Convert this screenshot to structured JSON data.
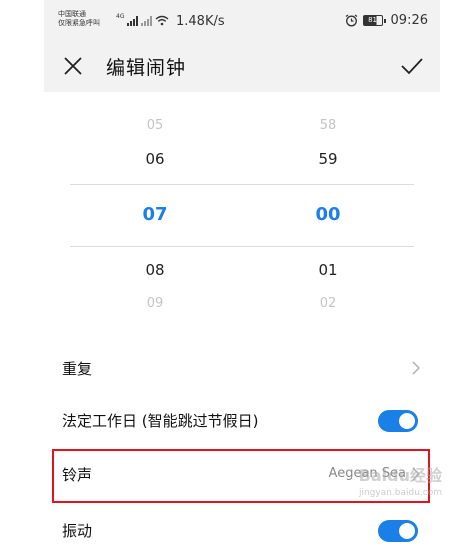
{
  "status_bar": {
    "carrier_line1": "中国联通",
    "carrier_line2": "仅限紧急呼叫",
    "network_tag": "4G",
    "speed": "1.48K/s",
    "battery_level": "81",
    "time": "09:26"
  },
  "header": {
    "title": "编辑闹钟",
    "close_icon": "close-icon",
    "confirm_icon": "check-icon"
  },
  "time_picker": {
    "hours": [
      "05",
      "06",
      "07",
      "08",
      "09"
    ],
    "minutes": [
      "58",
      "59",
      "00",
      "01",
      "02"
    ],
    "selected_hour": "07",
    "selected_minute": "00",
    "accent_color": "#1a7fe6"
  },
  "settings": {
    "repeat_label": "重复",
    "workday_label": "法定工作日 (智能跳过节假日)",
    "workday_enabled": true,
    "ringtone_label": "铃声",
    "ringtone_value": "Aegean Sea",
    "vibrate_label": "振动",
    "vibrate_enabled": true
  },
  "highlight_color": "#e0141e",
  "watermark": {
    "text": "Baidu经验",
    "sub": "jingyan.baidu.com"
  }
}
